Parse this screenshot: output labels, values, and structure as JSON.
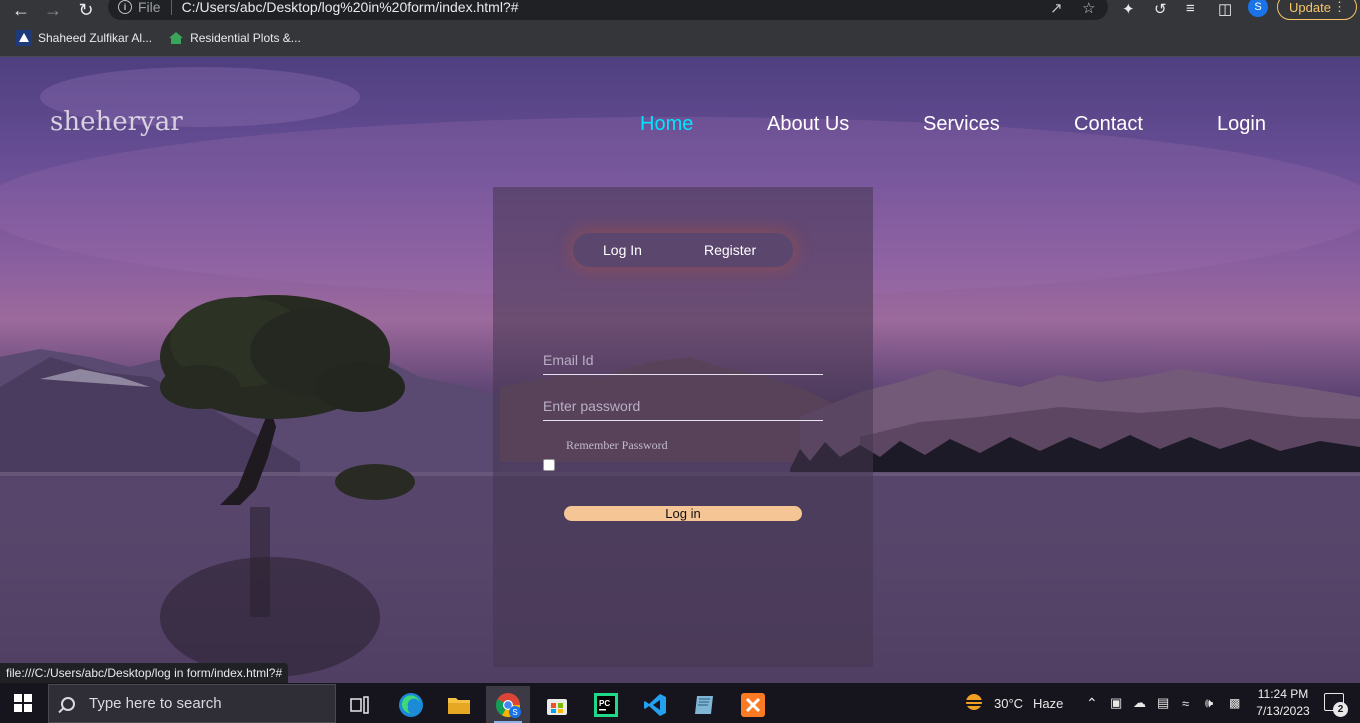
{
  "browser": {
    "url_scheme": "File",
    "url": "C:/Users/abc/Desktop/log%20in%20form/index.html?#",
    "update_label": "Update",
    "profile_initial": "S",
    "bookmarks": [
      {
        "label": "Shaheed Zulfikar Al..."
      },
      {
        "label": "Residential Plots &..."
      }
    ],
    "status_url": "file:///C:/Users/abc/Desktop/log in form/index.html?#"
  },
  "page": {
    "brand": "sheheryar",
    "nav": [
      "Home",
      "About Us",
      "Services",
      "Contact",
      "Login"
    ],
    "active_nav": "Home",
    "active_color": "#00e5ff",
    "form": {
      "tab_login": "Log In",
      "tab_register": "Register",
      "email_placeholder": "Email Id",
      "password_placeholder": "Enter password",
      "remember_label": "Remember Password",
      "submit_label": "Log in",
      "submit_color": "#f5c596"
    }
  },
  "taskbar": {
    "search_placeholder": "Type here to search",
    "weather_temp": "30°C",
    "weather_desc": "Haze",
    "time": "11:24 PM",
    "date": "7/13/2023",
    "notification_count": "2",
    "apps": [
      "task-view",
      "edge",
      "file-explorer",
      "chrome",
      "store",
      "pycharm",
      "vscode",
      "notepad",
      "xampp"
    ]
  }
}
